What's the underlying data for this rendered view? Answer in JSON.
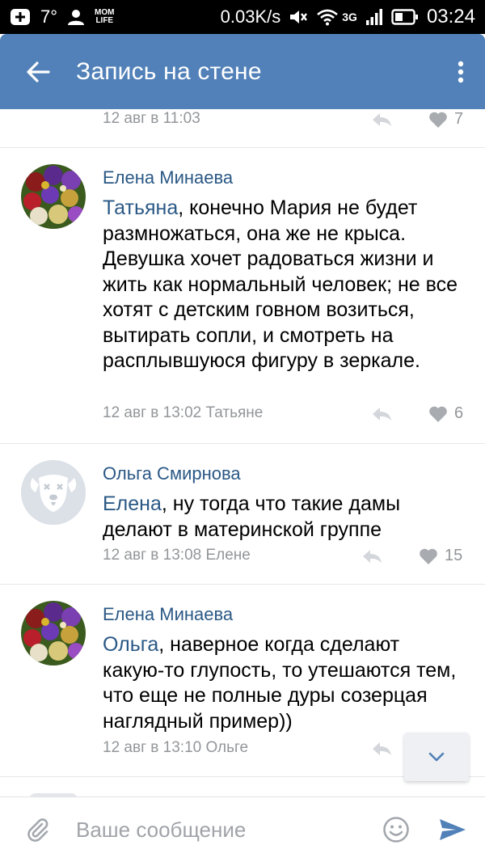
{
  "status_bar": {
    "temperature": "7°",
    "app_badge_line1": "MOM",
    "app_badge_line2": "LIFE",
    "net_speed": "0.03K/s",
    "network_type": "3G",
    "time": "03:24"
  },
  "app_bar": {
    "title": "Запись на стене"
  },
  "feed": {
    "top_partial": {
      "meta": "12 авг в 11:03",
      "likes": "7"
    },
    "comments": [
      {
        "author": "Елена Минаева",
        "mention": "Татьяна",
        "text": ", конечно Мария не будет размножаться, она же не крыса. Девушка хочет радоваться жизни и жить как нормальный человек; не все хотят с детским говном возиться, вытирать сопли, и смотреть на расплывшуюся фигуру в зеркале.",
        "meta": "12 авг в 13:02 Татьяне",
        "likes": "6",
        "avatar": "flowers-avatar"
      },
      {
        "author": "Ольга Смирнова",
        "mention": "Елена",
        "text": ", ну тогда что такие дамы делают в материнской группе",
        "meta": "12 авг в 13:08 Елене",
        "likes": "15",
        "avatar": "default-dog-avatar"
      },
      {
        "author": "Елена Минаева",
        "mention": "Ольга",
        "text": ", наверное когда сделают какую-то глупость, то утешаются тем, что еще не полные дуры созерцая наглядный пример))",
        "meta": "12 авг в 13:10 Ольге",
        "likes": "",
        "avatar": "flowers-avatar"
      }
    ]
  },
  "compose": {
    "placeholder": "Ваше сообщение"
  },
  "colors": {
    "header": "#5181b8",
    "link": "#2a5885",
    "meta": "#939699",
    "divider": "#e7e8ec"
  }
}
